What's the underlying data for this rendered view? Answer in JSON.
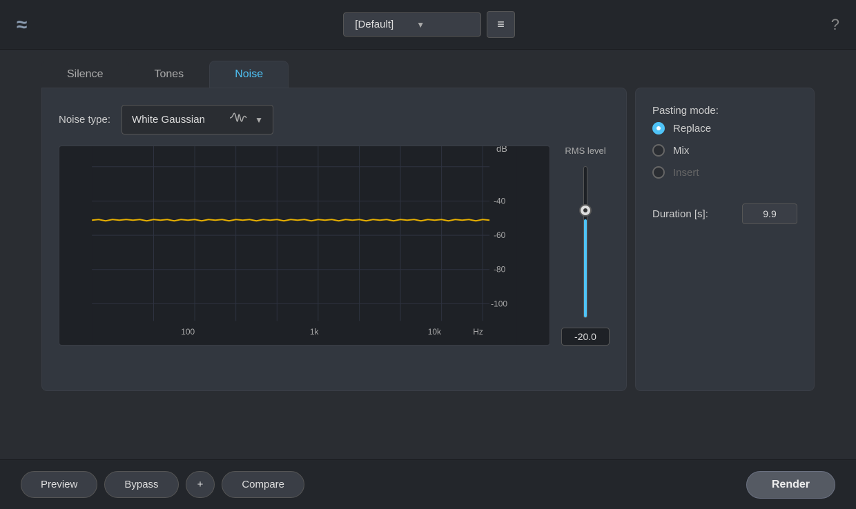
{
  "header": {
    "logo": "≈",
    "preset": "[Default]",
    "menu_icon": "≡",
    "help_icon": "?"
  },
  "tabs": [
    {
      "id": "silence",
      "label": "Silence",
      "active": false
    },
    {
      "id": "tones",
      "label": "Tones",
      "active": false
    },
    {
      "id": "noise",
      "label": "Noise",
      "active": true
    }
  ],
  "noise": {
    "noise_type_label": "Noise type:",
    "noise_type_value": "White Gaussian",
    "rms_label": "RMS level",
    "rms_value": "-20.0",
    "chart": {
      "db_labels": [
        "dB",
        "-40",
        "-60",
        "-80",
        "-100"
      ],
      "hz_labels": [
        "100",
        "1k",
        "10k",
        "Hz"
      ]
    }
  },
  "pasting": {
    "section_label": "Pasting mode:",
    "options": [
      {
        "id": "replace",
        "label": "Replace",
        "active": true
      },
      {
        "id": "mix",
        "label": "Mix",
        "active": false
      },
      {
        "id": "insert",
        "label": "Insert",
        "active": false,
        "disabled": true
      }
    ],
    "duration_label": "Duration [s]:",
    "duration_value": "9.9"
  },
  "footer": {
    "preview_label": "Preview",
    "bypass_label": "Bypass",
    "plus_label": "+",
    "compare_label": "Compare",
    "render_label": "Render"
  }
}
